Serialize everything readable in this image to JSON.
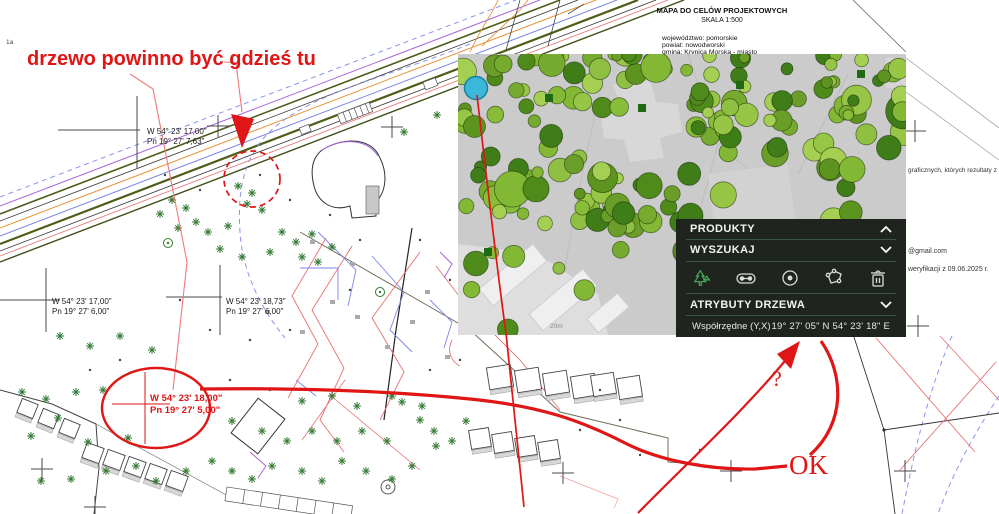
{
  "map": {
    "corner_label": "1a",
    "title_block": {
      "title": "MAPA DO CELÓW PROJEKTOWYCH",
      "scale": "SKALA 1:500",
      "province": "województwo: pomorskie",
      "county": "powiat: nowodworski",
      "municipality": "gmina: Krynica Morska - miasto"
    },
    "coordinate_labels": [
      {
        "lat": "W 54° 23' 17,00\"",
        "lon": "Pn 19° 27' 7,63\""
      },
      {
        "lat": "W 54° 23' 17,00\"",
        "lon": "Pn 19° 27' 6,00\""
      },
      {
        "lat": "W 54° 23' 18,73\"",
        "lon": "Pn 19° 27' 6,00\""
      },
      {
        "lat": "W 54° 23' 18,00\"",
        "lon": "Pn 19° 27' 5,00\""
      }
    ],
    "side_notes": {
      "note1": "graficznych, których rezultaty z",
      "note2": "@gmail.com",
      "note3": "weryfikacji z 09.06.2025 r."
    }
  },
  "annotations": {
    "tree_note": "drzewo powinno być gdzieś tu",
    "ok": "OK",
    "question": "?",
    "red_color": "#e01515"
  },
  "viewer": {
    "scale_label": "20m",
    "selected_tree_color": "#3ab7d9",
    "panel": {
      "bg_color": "#20241f",
      "sections": [
        {
          "label": "PRODUKTY",
          "chevron": "up"
        },
        {
          "label": "WYSZUKAJ",
          "chevron": "down"
        }
      ],
      "tools": [
        {
          "name": "tree-tool",
          "active": true
        },
        {
          "name": "measure-link-tool",
          "active": false
        },
        {
          "name": "point-select-tool",
          "active": false
        },
        {
          "name": "lasso-tool",
          "active": false
        },
        {
          "name": "delete-tool",
          "active": false
        }
      ],
      "attributes_section": {
        "label": "ATRYBUTY DRZEWA",
        "chevron": "down"
      },
      "coords_row": {
        "label": "Współrzędne (Y,X)",
        "value": "19° 27' 05\" N 54° 23' 18\" E"
      }
    }
  }
}
